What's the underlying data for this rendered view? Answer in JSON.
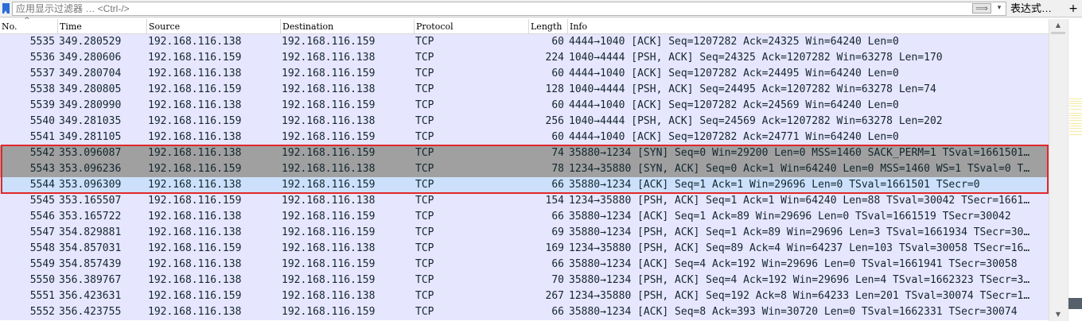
{
  "filter": {
    "placeholder": "应用显示过滤器 … <Ctrl-/>",
    "apply_arrow": "⟹",
    "dropdown": "▾",
    "expression_label": "表达式…",
    "add_label": "+"
  },
  "columns": {
    "no": "No.",
    "time": "Time",
    "source": "Source",
    "destination": "Destination",
    "protocol": "Protocol",
    "length": "Length",
    "info": "Info",
    "sort_indicator": "^"
  },
  "packets": [
    {
      "no": "5535",
      "time": "349.280529",
      "src": "192.168.116.138",
      "dst": "192.168.116.159",
      "proto": "TCP",
      "len": "60",
      "info": "4444→1040 [ACK] Seq=1207282 Ack=24325 Win=64240 Len=0",
      "bg": "#e7e6ff",
      "fg": "#12272e"
    },
    {
      "no": "5536",
      "time": "349.280606",
      "src": "192.168.116.159",
      "dst": "192.168.116.138",
      "proto": "TCP",
      "len": "224",
      "info": "1040→4444 [PSH, ACK] Seq=24325 Ack=1207282 Win=63278 Len=170",
      "bg": "#e7e6ff",
      "fg": "#12272e"
    },
    {
      "no": "5537",
      "time": "349.280704",
      "src": "192.168.116.138",
      "dst": "192.168.116.159",
      "proto": "TCP",
      "len": "60",
      "info": "4444→1040 [ACK] Seq=1207282 Ack=24495 Win=64240 Len=0",
      "bg": "#e7e6ff",
      "fg": "#12272e"
    },
    {
      "no": "5538",
      "time": "349.280805",
      "src": "192.168.116.159",
      "dst": "192.168.116.138",
      "proto": "TCP",
      "len": "128",
      "info": "1040→4444 [PSH, ACK] Seq=24495 Ack=1207282 Win=63278 Len=74",
      "bg": "#e7e6ff",
      "fg": "#12272e"
    },
    {
      "no": "5539",
      "time": "349.280990",
      "src": "192.168.116.138",
      "dst": "192.168.116.159",
      "proto": "TCP",
      "len": "60",
      "info": "4444→1040 [ACK] Seq=1207282 Ack=24569 Win=64240 Len=0",
      "bg": "#e7e6ff",
      "fg": "#12272e"
    },
    {
      "no": "5540",
      "time": "349.281035",
      "src": "192.168.116.159",
      "dst": "192.168.116.138",
      "proto": "TCP",
      "len": "256",
      "info": "1040→4444 [PSH, ACK] Seq=24569 Ack=1207282 Win=63278 Len=202",
      "bg": "#e7e6ff",
      "fg": "#12272e"
    },
    {
      "no": "5541",
      "time": "349.281105",
      "src": "192.168.116.138",
      "dst": "192.168.116.159",
      "proto": "TCP",
      "len": "60",
      "info": "4444→1040 [ACK] Seq=1207282 Ack=24771 Win=64240 Len=0",
      "bg": "#e7e6ff",
      "fg": "#12272e"
    },
    {
      "no": "5542",
      "time": "353.096087",
      "src": "192.168.116.138",
      "dst": "192.168.116.159",
      "proto": "TCP",
      "len": "74",
      "info": "35880→1234 [SYN] Seq=0 Win=29200 Len=0 MSS=1460 SACK_PERM=1 TSval=1661501…",
      "bg": "#a0a0a0",
      "fg": "#12272e"
    },
    {
      "no": "5543",
      "time": "353.096236",
      "src": "192.168.116.159",
      "dst": "192.168.116.138",
      "proto": "TCP",
      "len": "78",
      "info": "1234→35880 [SYN, ACK] Seq=0 Ack=1 Win=64240 Len=0 MSS=1460 WS=1 TSval=0 T…",
      "bg": "#a0a0a0",
      "fg": "#12272e"
    },
    {
      "no": "5544",
      "time": "353.096309",
      "src": "192.168.116.138",
      "dst": "192.168.116.159",
      "proto": "TCP",
      "len": "66",
      "info": "35880→1234 [ACK] Seq=1 Ack=1 Win=29696 Len=0 TSval=1661501 TSecr=0",
      "bg": "#cce0fc",
      "fg": "#12272e"
    },
    {
      "no": "5545",
      "time": "353.165507",
      "src": "192.168.116.159",
      "dst": "192.168.116.138",
      "proto": "TCP",
      "len": "154",
      "info": "1234→35880 [PSH, ACK] Seq=1 Ack=1 Win=64240 Len=88 TSval=30042 TSecr=1661…",
      "bg": "#e7e6ff",
      "fg": "#12272e"
    },
    {
      "no": "5546",
      "time": "353.165722",
      "src": "192.168.116.138",
      "dst": "192.168.116.159",
      "proto": "TCP",
      "len": "66",
      "info": "35880→1234 [ACK] Seq=1 Ack=89 Win=29696 Len=0 TSval=1661519 TSecr=30042",
      "bg": "#e7e6ff",
      "fg": "#12272e"
    },
    {
      "no": "5547",
      "time": "354.829881",
      "src": "192.168.116.138",
      "dst": "192.168.116.159",
      "proto": "TCP",
      "len": "69",
      "info": "35880→1234 [PSH, ACK] Seq=1 Ack=89 Win=29696 Len=3 TSval=1661934 TSecr=30…",
      "bg": "#e7e6ff",
      "fg": "#12272e"
    },
    {
      "no": "5548",
      "time": "354.857031",
      "src": "192.168.116.159",
      "dst": "192.168.116.138",
      "proto": "TCP",
      "len": "169",
      "info": "1234→35880 [PSH, ACK] Seq=89 Ack=4 Win=64237 Len=103 TSval=30058 TSecr=16…",
      "bg": "#e7e6ff",
      "fg": "#12272e"
    },
    {
      "no": "5549",
      "time": "354.857439",
      "src": "192.168.116.138",
      "dst": "192.168.116.159",
      "proto": "TCP",
      "len": "66",
      "info": "35880→1234 [ACK] Seq=4 Ack=192 Win=29696 Len=0 TSval=1661941 TSecr=30058",
      "bg": "#e7e6ff",
      "fg": "#12272e"
    },
    {
      "no": "5550",
      "time": "356.389767",
      "src": "192.168.116.138",
      "dst": "192.168.116.159",
      "proto": "TCP",
      "len": "70",
      "info": "35880→1234 [PSH, ACK] Seq=4 Ack=192 Win=29696 Len=4 TSval=1662323 TSecr=3…",
      "bg": "#e7e6ff",
      "fg": "#12272e"
    },
    {
      "no": "5551",
      "time": "356.423631",
      "src": "192.168.116.159",
      "dst": "192.168.116.138",
      "proto": "TCP",
      "len": "267",
      "info": "1234→35880 [PSH, ACK] Seq=192 Ack=8 Win=64233 Len=201 TSval=30074 TSecr=1…",
      "bg": "#e7e6ff",
      "fg": "#12272e"
    },
    {
      "no": "5552",
      "time": "356.423755",
      "src": "192.168.116.138",
      "dst": "192.168.116.159",
      "proto": "TCP",
      "len": "66",
      "info": "35880→1234 [ACK] Seq=8 Ack=393 Win=30720 Len=0 TSval=1662331 TSecr=30074",
      "bg": "#e7e6ff",
      "fg": "#12272e"
    }
  ],
  "scrollbar": {
    "up": "▲",
    "down": "▼"
  },
  "colors": {
    "highlight_border": "#e2282a",
    "tcp_row": "#e7e6ff",
    "syn_row": "#a0a0a0",
    "selected_row": "#cce0fc",
    "minimap_marks": "#f5eaa0"
  }
}
